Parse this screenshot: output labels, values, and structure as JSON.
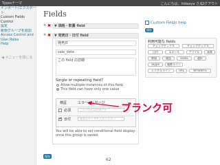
{
  "adminbar": {
    "site": "Typesテーマ",
    "greeting": "こんにちは、hideaya さん！",
    "logout": "ログアウト"
  },
  "sidebar": {
    "items": [
      "インポート/エクスポート",
      "ト",
      "Custom Fields",
      "Control",
      "設定",
      "新規グループを追加",
      "Access Control and",
      "User Roles",
      "Help"
    ],
    "collapse": "◀ メニューを閉じる"
  },
  "page": {
    "title": "Fields"
  },
  "fields": [
    {
      "title": "▼ 価格・数量 field"
    },
    {
      "title": "▼ 発売日・日付 field"
    }
  ],
  "editor": {
    "name": "発売日",
    "slug": "sale_date",
    "description": "この field の詳細",
    "single_repeating_title": "Single or repeating field?",
    "options": [
      "Allow multiple-instances of this field",
      "This field can have only one value"
    ],
    "validation": {
      "headers": [
        "検証",
        "エラーメッセージ"
      ],
      "rows": [
        {
          "label": "必須",
          "checked": false,
          "message": "この field は必須です"
        },
        {
          "label": "日付",
          "checked": true,
          "message": "有効なデータを入力ください"
        }
      ]
    },
    "note": "You will be able to set conditional field display once this group is saved."
  },
  "annotation": "ブランク可",
  "save_label": "保存",
  "page_number": "62",
  "right": {
    "help_link": "Custom Fields help",
    "help_button": "保存",
    "panel_title": "利用可能な fields",
    "chips": [
      "チェックボックス",
      "チェックボックス",
      "日付",
      "Eメール",
      "ファイル",
      "画像",
      "数値",
      "電話",
      "Radio",
      "選択",
      "Skype",
      "複数ライン",
      "シングルライン",
      "URL",
      "WYSIWYG"
    ]
  },
  "colors": {
    "accent": "#21759b",
    "annotation": "#e8003d",
    "remove": "#d40000"
  }
}
